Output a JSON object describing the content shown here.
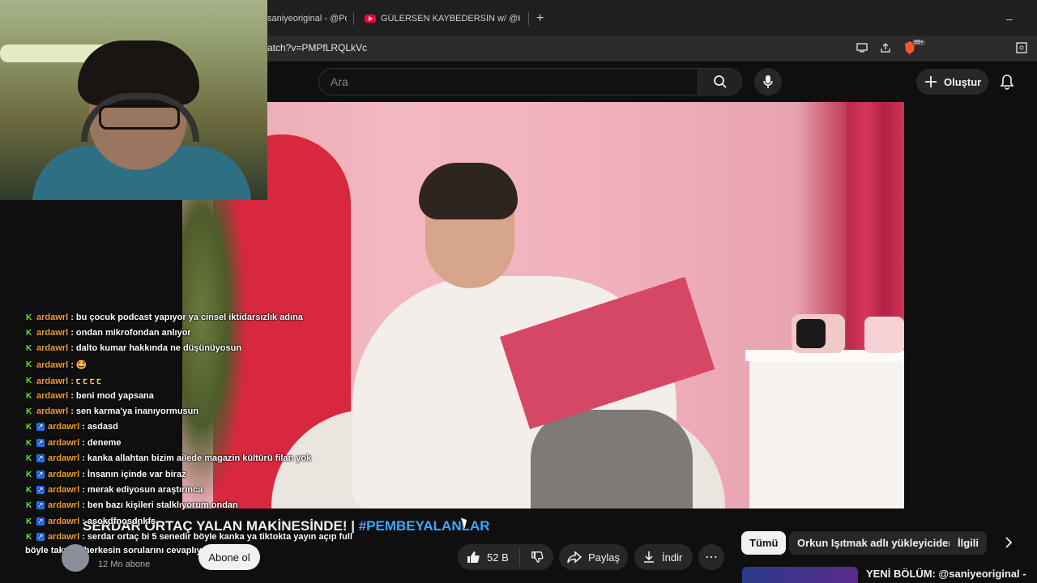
{
  "browser": {
    "tabs": [
      {
        "title": "saniyeoriginal - @Po"
      },
      {
        "title": "GÜLERSEN KAYBEDERSİN w/ @Harun"
      }
    ],
    "new_tab": "+",
    "minimize": "–",
    "url": "atch?v=PMPfLRQLkVc",
    "brave_badge": "99+"
  },
  "header": {
    "search_placeholder": "Ara",
    "create_label": "Oluştur"
  },
  "chat": [
    {
      "user": "ardawrl",
      "msg": ": bu çocuk podcast yapıyor ya cinsel iktidarsızlık adına",
      "badge": "k"
    },
    {
      "user": "ardawrl",
      "msg": ": ondan mikrofondan anlıyor",
      "badge": "k"
    },
    {
      "user": "ardawrl",
      "msg": ": dalto kumar hakkında ne düşünüyosun",
      "badge": "k"
    },
    {
      "user": "ardawrl",
      "msg": ": 🤩",
      "badge": "k"
    },
    {
      "user": "ardawrl",
      "msg": ": ꞇ ꞇ ꞇ ꞇ",
      "badge": "k"
    },
    {
      "user": "ardawrl",
      "msg": ": beni mod yapsana",
      "badge": "k"
    },
    {
      "user": "ardawrl",
      "msg": ": sen karma'ya inanıyormusun",
      "badge": "k"
    },
    {
      "user": "ardawrl",
      "msg": ": asdasd",
      "badge": "kb"
    },
    {
      "user": "ardawrl",
      "msg": ": deneme",
      "badge": "kb"
    },
    {
      "user": "ardawrl",
      "msg": ": kanka allahtan bizim ailede magazin kültürü filan yok",
      "badge": "kb"
    },
    {
      "user": "ardawrl",
      "msg": ": İnsanın içinde var biraz",
      "badge": "kb"
    },
    {
      "user": "ardawrl",
      "msg": ": merak ediyosun araştırınca",
      "badge": "kb"
    },
    {
      "user": "ardawrl",
      "msg": ": ben bazı kişileri stalklıyorum ondan",
      "badge": "kb"
    },
    {
      "user": "ardawrl",
      "msg": ": asokdfnosdnkfs",
      "badge": "kb"
    },
    {
      "user": "ardawrl",
      "msg": ": serdar ortaç bi 5 senedir böyle kanka ya tiktokta yayın açıp full",
      "badge": "kb"
    }
  ],
  "chat_wrap": "böyle takılıyo herkesin sorularını cevaplıyo",
  "video": {
    "title_main": "SERDAR ORTAÇ YALAN MAKİNESİNDE! | ",
    "title_tag": "#PEMBEYALANLAR",
    "subscribers": "12 Mn abone",
    "subscribe_label": "Abone ol",
    "likes": "52 B",
    "share_label": "Paylaş",
    "download_label": "İndir"
  },
  "chips": [
    "Tümü",
    "Orkun Işıtmak adlı yükleyiciden",
    "İlgili"
  ],
  "recommendation": {
    "title": "YENİ BÖLÜM: @saniyeoriginal -"
  }
}
